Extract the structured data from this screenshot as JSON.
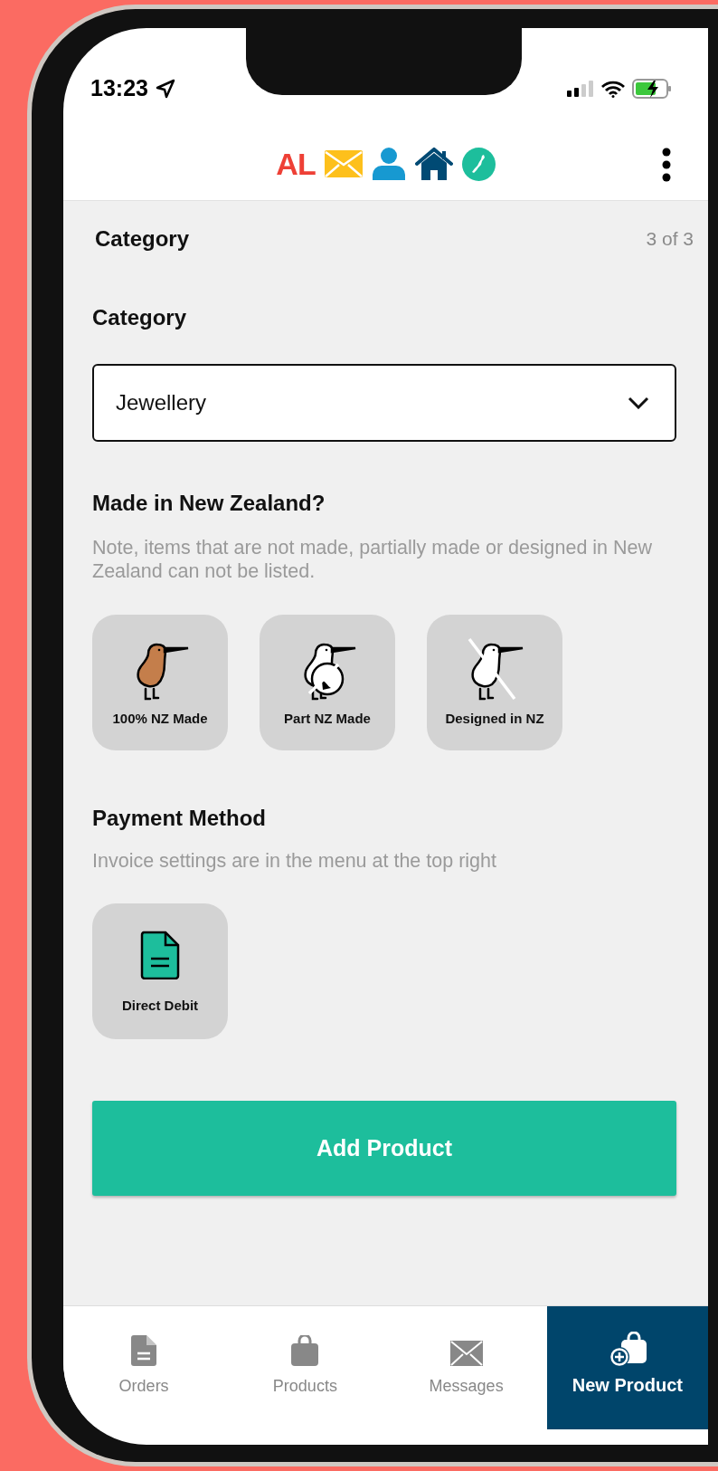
{
  "status_bar": {
    "time": "13:23"
  },
  "header": {
    "logo": "AL"
  },
  "step": {
    "title": "Category",
    "progress": "3 of 3"
  },
  "category": {
    "label": "Category",
    "value": "Jewellery"
  },
  "made_in_nz": {
    "title": "Made in New Zealand?",
    "note": "Note, items that are not made, partially made or designed in New Zealand can not be listed.",
    "options": [
      {
        "kind": "full",
        "label": "100% NZ Made"
      },
      {
        "kind": "part",
        "label": "Part NZ Made"
      },
      {
        "kind": "designed",
        "label": "Designed in NZ"
      }
    ]
  },
  "payment": {
    "title": "Payment Method",
    "note": "Invoice settings are in the menu at the top right",
    "options": [
      {
        "kind": "invoice",
        "label": "Direct Debit"
      }
    ]
  },
  "submit": {
    "label": "Add Product"
  },
  "bottom_nav": [
    {
      "kind": "orders",
      "label": "Orders",
      "selected": false
    },
    {
      "kind": "products",
      "label": "Products",
      "selected": false
    },
    {
      "kind": "messages",
      "label": "Messages",
      "selected": false
    },
    {
      "kind": "new",
      "label": "New Product",
      "selected": true
    }
  ]
}
